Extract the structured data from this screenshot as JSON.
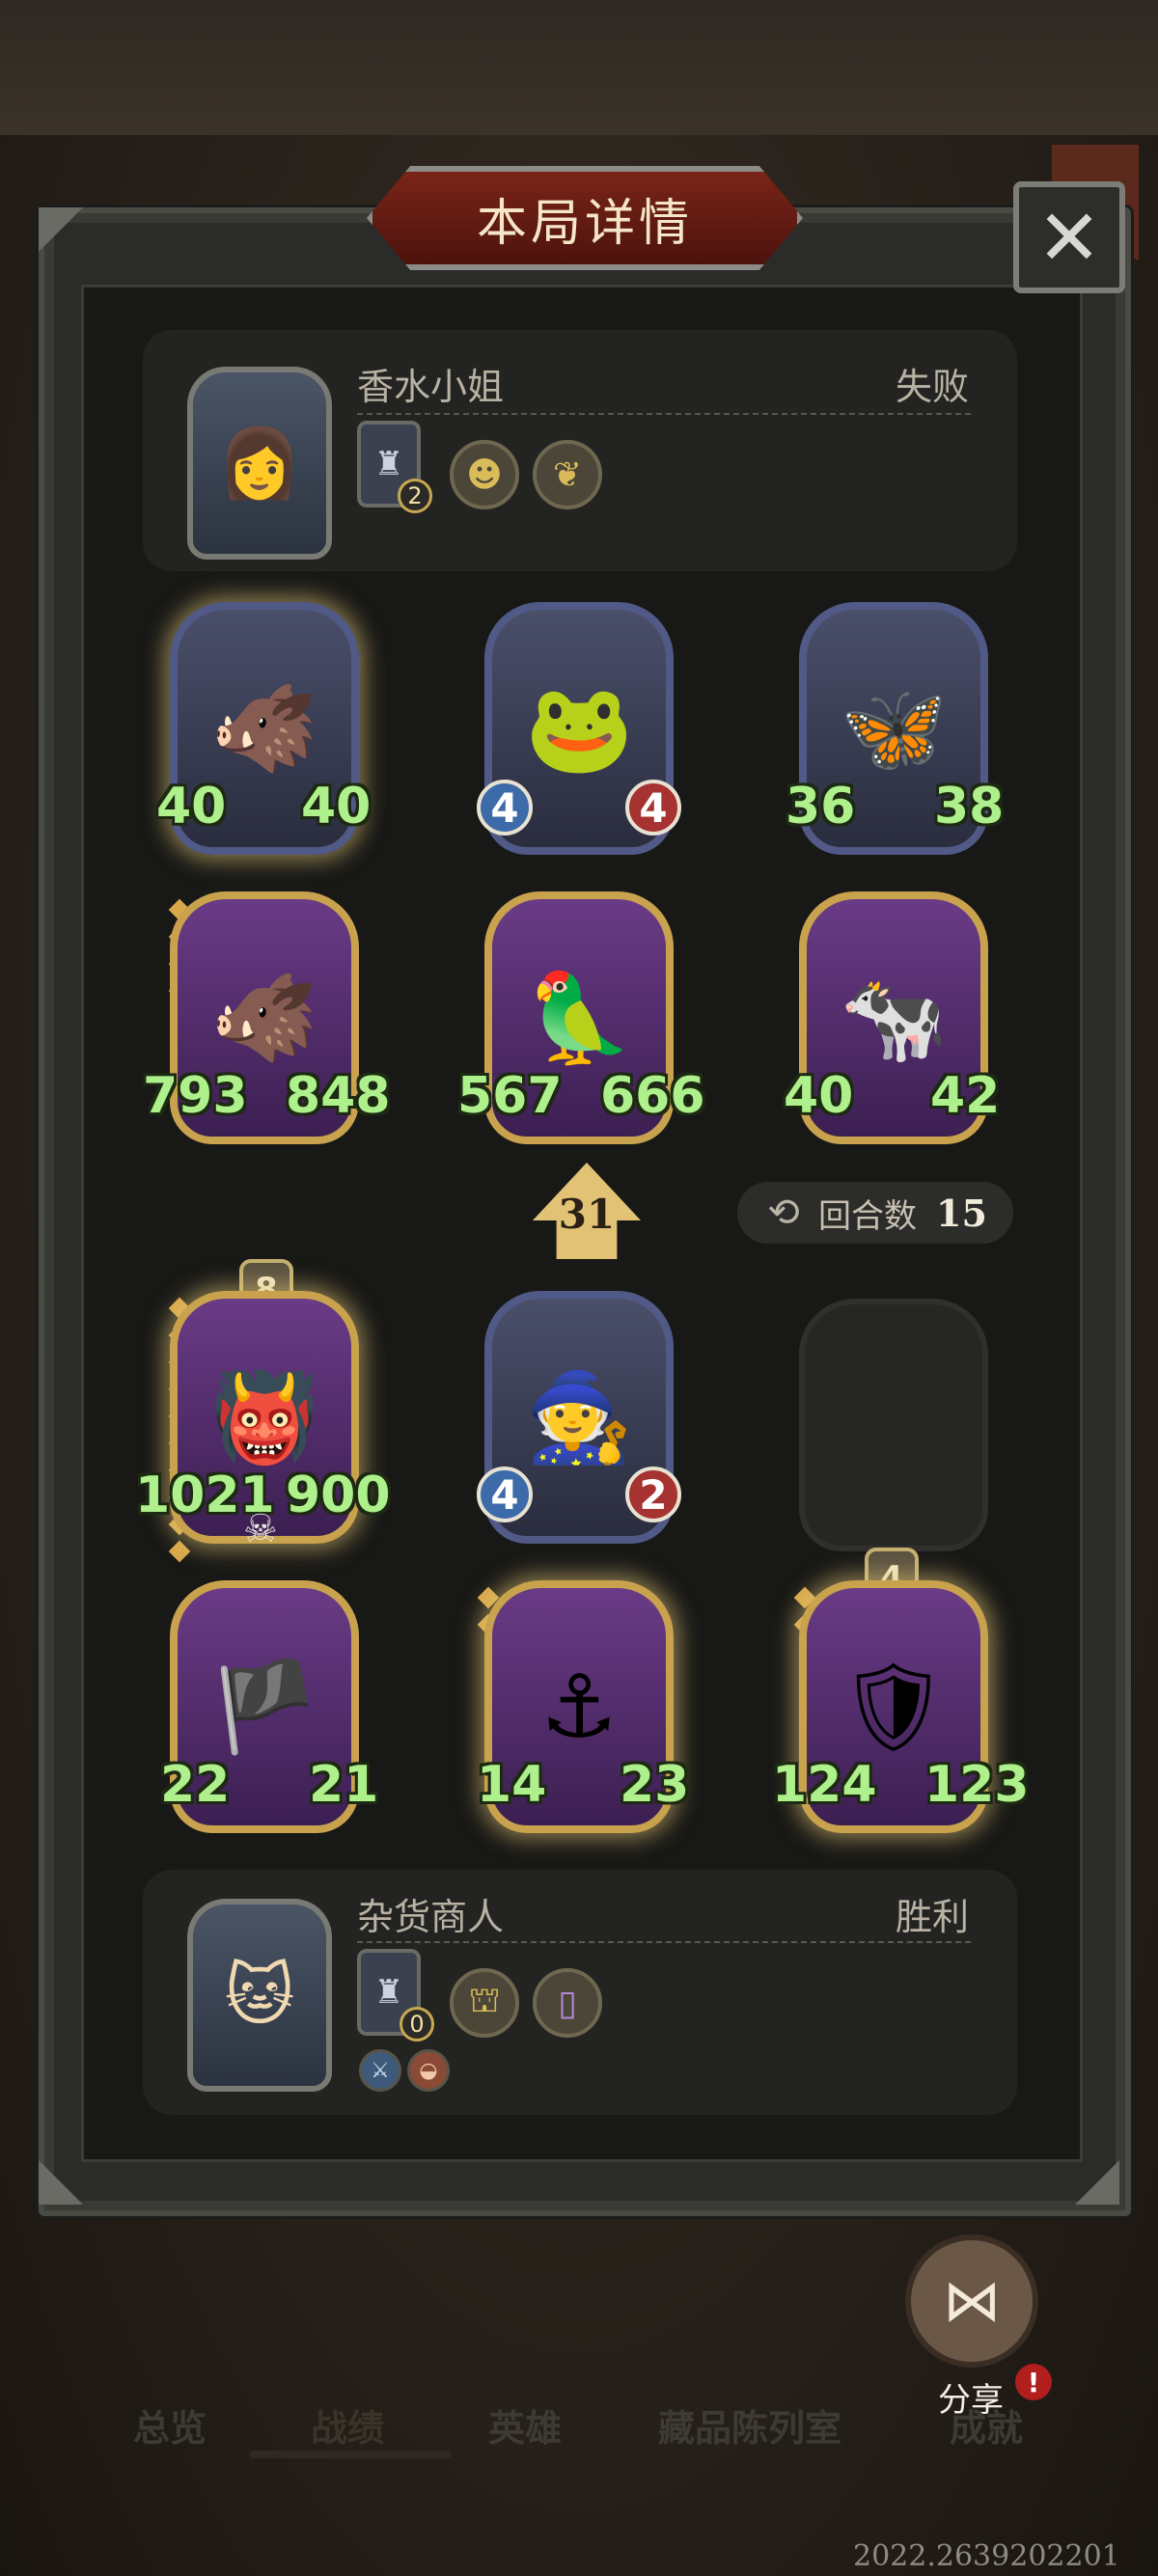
{
  "dialog": {
    "title": "本局详情",
    "close_icon": "close-icon"
  },
  "opponent": {
    "name": "香水小姐",
    "result": "失败",
    "tier_level": "2",
    "portrait_icon": "perfume-lady-portrait",
    "items": [
      "gold-mask-item-icon",
      "golden-feather-item-icon"
    ]
  },
  "opponent_cards": [
    {
      "name": "boar-card",
      "atk": "40",
      "hp": "40",
      "style": "blue",
      "glow": true
    },
    {
      "name": "apple-frog-card",
      "atk": "4",
      "hp": "4",
      "style": "blue",
      "glow": false
    },
    {
      "name": "butterfly-card",
      "atk": "36",
      "hp": "38",
      "style": "blue",
      "glow": false
    },
    {
      "name": "golden-boar-card",
      "atk": "793",
      "hp": "848",
      "style": "gold",
      "glow": false
    },
    {
      "name": "parrot-card",
      "atk": "567",
      "hp": "666",
      "style": "gold",
      "glow": false
    },
    {
      "name": "cow-card",
      "atk": "40",
      "hp": "42",
      "style": "gold",
      "glow": false
    }
  ],
  "damage_badge": "31",
  "round": {
    "label": "回合数",
    "value": "15"
  },
  "player_cards": [
    {
      "name": "orc-captain-card",
      "atk": "1021",
      "hp": "900",
      "style": "gold",
      "glow": true,
      "level": "8"
    },
    {
      "name": "flower-witch-card",
      "atk": "4",
      "hp": "2",
      "style": "blue",
      "glow": false
    },
    {
      "name": "empty-slot",
      "empty": true
    },
    {
      "name": "pirate-lady-card",
      "atk": "22",
      "hp": "21",
      "style": "gold",
      "glow": false
    },
    {
      "name": "pirate-captain-card",
      "atk": "14",
      "hp": "23",
      "style": "gold",
      "glow": true
    },
    {
      "name": "shield-knight-card",
      "atk": "124",
      "hp": "123",
      "style": "gold",
      "glow": true,
      "level": "4"
    }
  ],
  "player": {
    "name": "杂货商人",
    "result": "胜利",
    "tier_level": "0",
    "portrait_icon": "cat-merchant-portrait",
    "items": [
      "tombstone-item-icon",
      "purple-door-item-icon"
    ],
    "buffs": [
      "sword-buff-icon",
      "bowl-buff-icon"
    ]
  },
  "share": {
    "label": "分享",
    "notify": "!"
  },
  "nav": {
    "items": [
      "总览",
      "战绩",
      "英雄",
      "藏品陈列室",
      "成就"
    ],
    "active": "战绩"
  },
  "footer_id": "2022.2639202201"
}
